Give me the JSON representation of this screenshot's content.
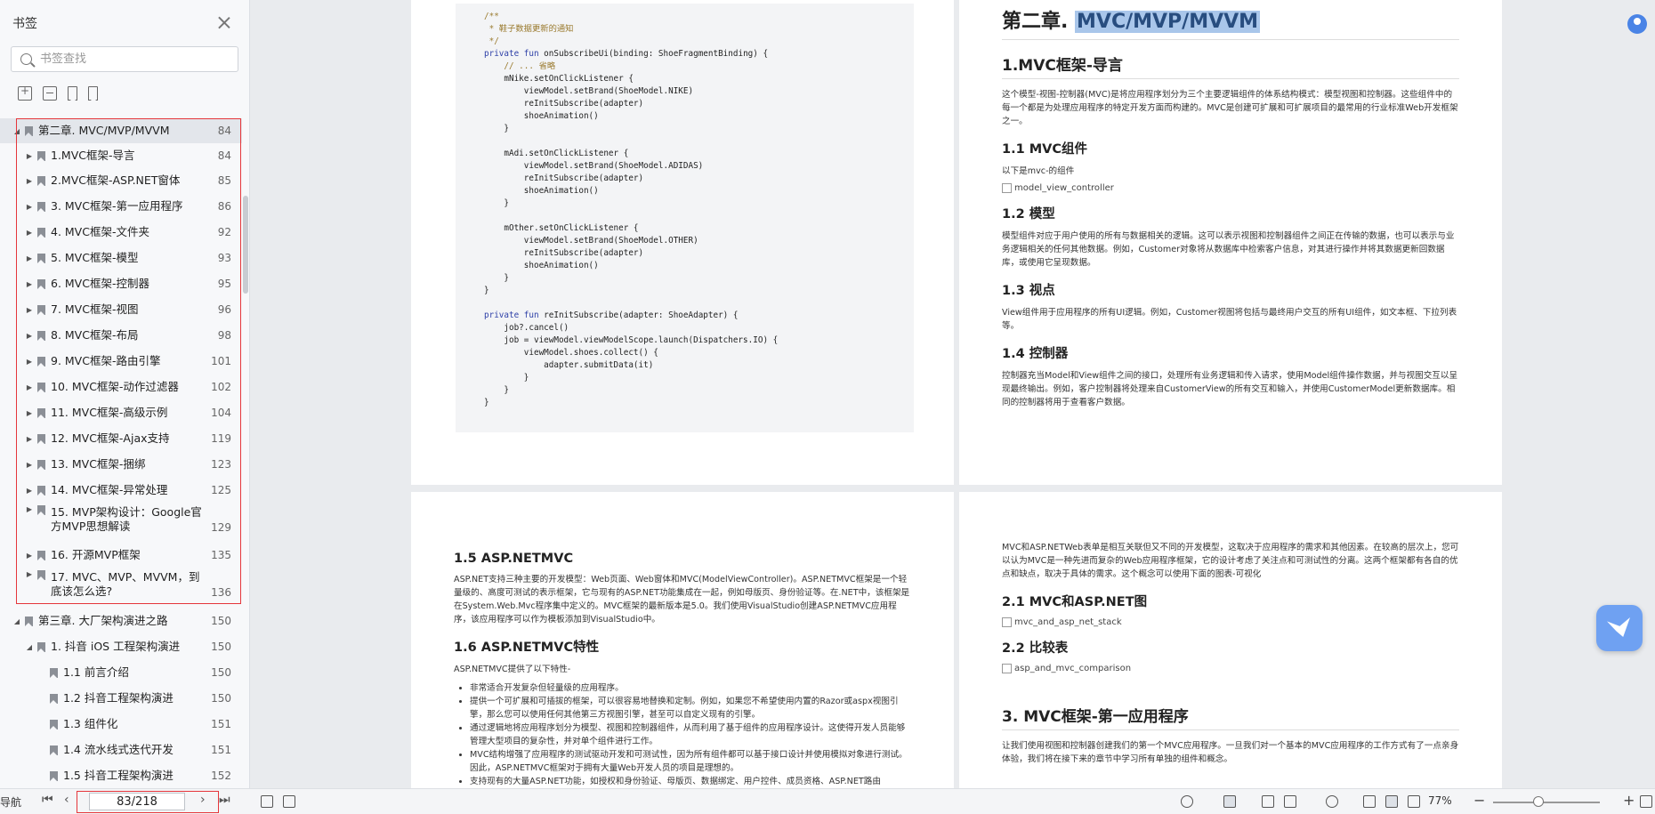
{
  "sidebar": {
    "title": "书签",
    "search_placeholder": "书签查找",
    "items": [
      {
        "label": "第二章. MVC/MVP/MVVM",
        "page": "84"
      },
      {
        "label": "1.MVC框架-导言",
        "page": "84"
      },
      {
        "label": "2.MVC框架-ASP.NET窗体",
        "page": "85"
      },
      {
        "label": "3. MVC框架-第一应用程序",
        "page": "86"
      },
      {
        "label": "4. MVC框架-文件夹",
        "page": "92"
      },
      {
        "label": "5. MVC框架-模型",
        "page": "93"
      },
      {
        "label": "6. MVC框架-控制器",
        "page": "95"
      },
      {
        "label": "7. MVC框架-视图",
        "page": "96"
      },
      {
        "label": "8. MVC框架-布局",
        "page": "98"
      },
      {
        "label": "9. MVC框架-路由引擎",
        "page": "101"
      },
      {
        "label": "10. MVC框架-动作过滤器",
        "page": "102"
      },
      {
        "label": "11. MVC框架-高级示例",
        "page": "104"
      },
      {
        "label": "12. MVC框架-Ajax支持",
        "page": "119"
      },
      {
        "label": "13. MVC框架-捆绑",
        "page": "123"
      },
      {
        "label": "14. MVC框架-异常处理",
        "page": "125"
      },
      {
        "label": "15. MVP架构设计：Google官方MVP思想解读",
        "page": "129"
      },
      {
        "label": "16. 开源MVP框架",
        "page": "135"
      },
      {
        "label": "17. MVC、MVP、MVVM，到底该怎么选?",
        "page": "136"
      },
      {
        "label": "第三章. 大厂架构演进之路",
        "page": "150"
      },
      {
        "label": "1. 抖音 iOS 工程架构演进",
        "page": "150"
      },
      {
        "label": "1.1 前言介绍",
        "page": "150"
      },
      {
        "label": "1.2 抖音工程架构演进",
        "page": "150"
      },
      {
        "label": "1.3 组件化",
        "page": "151"
      },
      {
        "label": "1.4 流水线式迭代开发",
        "page": "151"
      },
      {
        "label": "1.5 抖音工程架构演进",
        "page": "152"
      }
    ]
  },
  "code": {
    "lines": [
      "/**",
      " * 鞋子数据更新的通知",
      " */",
      "private fun onSubscribeUi(binding: ShoeFragmentBinding) {",
      "    // ... 省略",
      "    mNike.setOnClickListener {",
      "        viewModel.setBrand(ShoeModel.NIKE)",
      "        reInitSubscribe(adapter)",
      "        shoeAnimation()",
      "    }",
      "",
      "    mAdi.setOnClickListener {",
      "        viewModel.setBrand(ShoeModel.ADIDAS)",
      "        reInitSubscribe(adapter)",
      "        shoeAnimation()",
      "    }",
      "",
      "    mOther.setOnClickListener {",
      "        viewModel.setBrand(ShoeModel.OTHER)",
      "        reInitSubscribe(adapter)",
      "        shoeAnimation()",
      "    }",
      "}",
      "",
      "private fun reInitSubscribe(adapter: ShoeAdapter) {",
      "    job?.cancel()",
      "    job = viewModel.viewModelScope.launch(Dispatchers.IO) {",
      "        viewModel.shoes.collect() {",
      "            adapter.submitData(it)",
      "        }",
      "    }",
      "}"
    ]
  },
  "page2": {
    "chapter_prefix": "第二章. ",
    "chapter_highlight": "MVC/MVP/MVVM",
    "h_intro": "1.MVC框架-导言",
    "p_intro": "这个模型-视图-控制器(MVC)是将应用程序划分为三个主要逻辑组件的体系结构模式：模型视图和控制器。这些组件中的每一个都是为处理应用程序的特定开发方面而构建的。MVC是创建可扩展和可扩展项目的最常用的行业标准Web开发框架之一。",
    "h11": "1.1 MVC组件",
    "p11": "以下是mvc-的组件",
    "img11": "model_view_controller",
    "h12": "1.2 模型",
    "p12": "模型组件对应于用户使用的所有与数据相关的逻辑。这可以表示视图和控制器组件之间正在传输的数据，也可以表示与业务逻辑相关的任何其他数据。例如，Customer对象将从数据库中检索客户信息，对其进行操作并将其数据更新回数据库，或使用它呈现数据。",
    "h13": "1.3 视点",
    "p13": "View组件用于应用程序的所有UI逻辑。例如，Customer视图将包括与最终用户交互的所有UI组件，如文本框、下拉列表等。",
    "h14": "1.4 控制器",
    "p14": "控制器充当Model和View组件之间的接口，处理所有业务逻辑和传入请求，使用Model组件操作数据，并与视图交互以呈现最终输出。例如，客户控制器将处理来自CustomerView的所有交互和输入，并使用CustomerModel更新数据库。相同的控制器将用于查看客户数据。"
  },
  "page3": {
    "h15": "1.5 ASP.NETMVC",
    "p15": "ASP.NET支持三种主要的开发模型：Web页面、Web窗体和MVC(ModelViewController)。ASP.NETMVC框架是一个轻量级的、高度可测试的表示框架，它与现有的ASP.NET功能集成在一起，例如母版页、身份验证等。在.NET中，该框架是在System.Web.Mvc程序集中定义的。MVC框架的最新版本是5.0。我们使用VisualStudio创建ASP.NETMVC应用程序，该应用程序可以作为模板添加到VisualStudio中。",
    "h16": "1.6 ASP.NETMVC特性",
    "p16": "ASP.NETMVC提供了以下特性-",
    "bullets": [
      "非常适合开发复杂但轻量级的应用程序。",
      "提供一个可扩展和可插拔的框架，可以很容易地替换和定制。例如，如果您不希望使用内置的Razor或aspx视图引擎，那么您可以使用任何其他第三方视图引擎，甚至可以自定义现有的引擎。",
      "通过逻辑地将应用程序划分为模型、视图和控制器组件，从而利用了基于组件的应用程序设计。这使得开发人员能够管理大型项目的复杂性，并对单个组件进行工作。",
      "MVC结构增强了应用程序的测试驱动开发和可测试性，因为所有组件都可以基于接口设计并使用模拟对象进行测试。因此，ASP.NETMVC框架对于拥有大量Web开发人员的项目是理想的。",
      "支持现有的大量ASP.NET功能，如授权和身份验证、母版页、数据绑定、用户控件、成员资格、ASP.NET路由"
    ]
  },
  "page4": {
    "p_top": "MVC和ASP.NETWeb表单是相互关联但又不同的开发模型，这取决于应用程序的需求和其他因素。在较高的层次上，您可以认为MVC是一种先进而复杂的Web应用程序框架，它的设计考虑了关注点和可测试性的分离。这两个框架都有各自的优点和缺点，取决于具体的需求。这个概念可以使用下面的图表-可视化",
    "h21": "2.1 MVC和ASP.NET图",
    "img21": "mvc_and_asp_net_stack",
    "h22": "2.2 比较表",
    "img22": "asp_and_mvc_comparison",
    "h3": "3. MVC框架-第一应用程序",
    "p3": "让我们使用视图和控制器创建我们的第一个MVC应用程序。一旦我们对一个基本的MVC应用程序的工作方式有了一点亲身体验，我们将在接下来的章节中学习所有单独的组件和概念。"
  },
  "bottombar": {
    "nav_label": "导航",
    "page_indicator": "83/218",
    "zoom": "77%"
  },
  "colors": {
    "accent_red": "#e5363b",
    "highlight": "#a9c6ea",
    "brand_blue": "#4a84e6"
  }
}
